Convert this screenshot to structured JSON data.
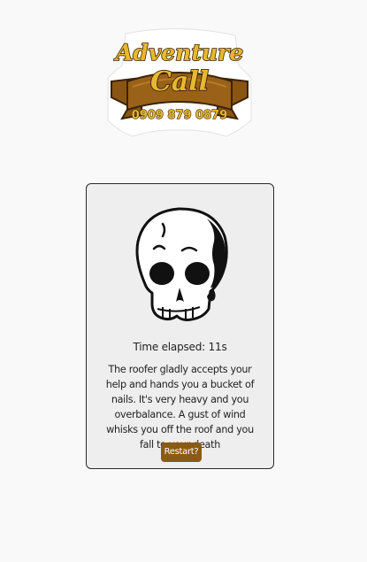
{
  "logo": {
    "line1": "Adventure",
    "line2": "Call",
    "phone": "0909 879 0879",
    "colors": {
      "gold": "#e7b82f",
      "banner": "#8a5512",
      "outline": "#3a2205"
    }
  },
  "game": {
    "icon": "skull-icon",
    "timer_text": "Time elapsed: 11s",
    "message": "The roofer gladly accepts your help and hands you a bucket of nails. It's very heavy and you overbalance. A gust of wind whisks you off the roof and you fall to your death",
    "restart_label": "Restart?",
    "colors": {
      "card_bg": "#eeeeee",
      "button_bg": "#8b5a14",
      "button_text": "#ffffff"
    }
  }
}
